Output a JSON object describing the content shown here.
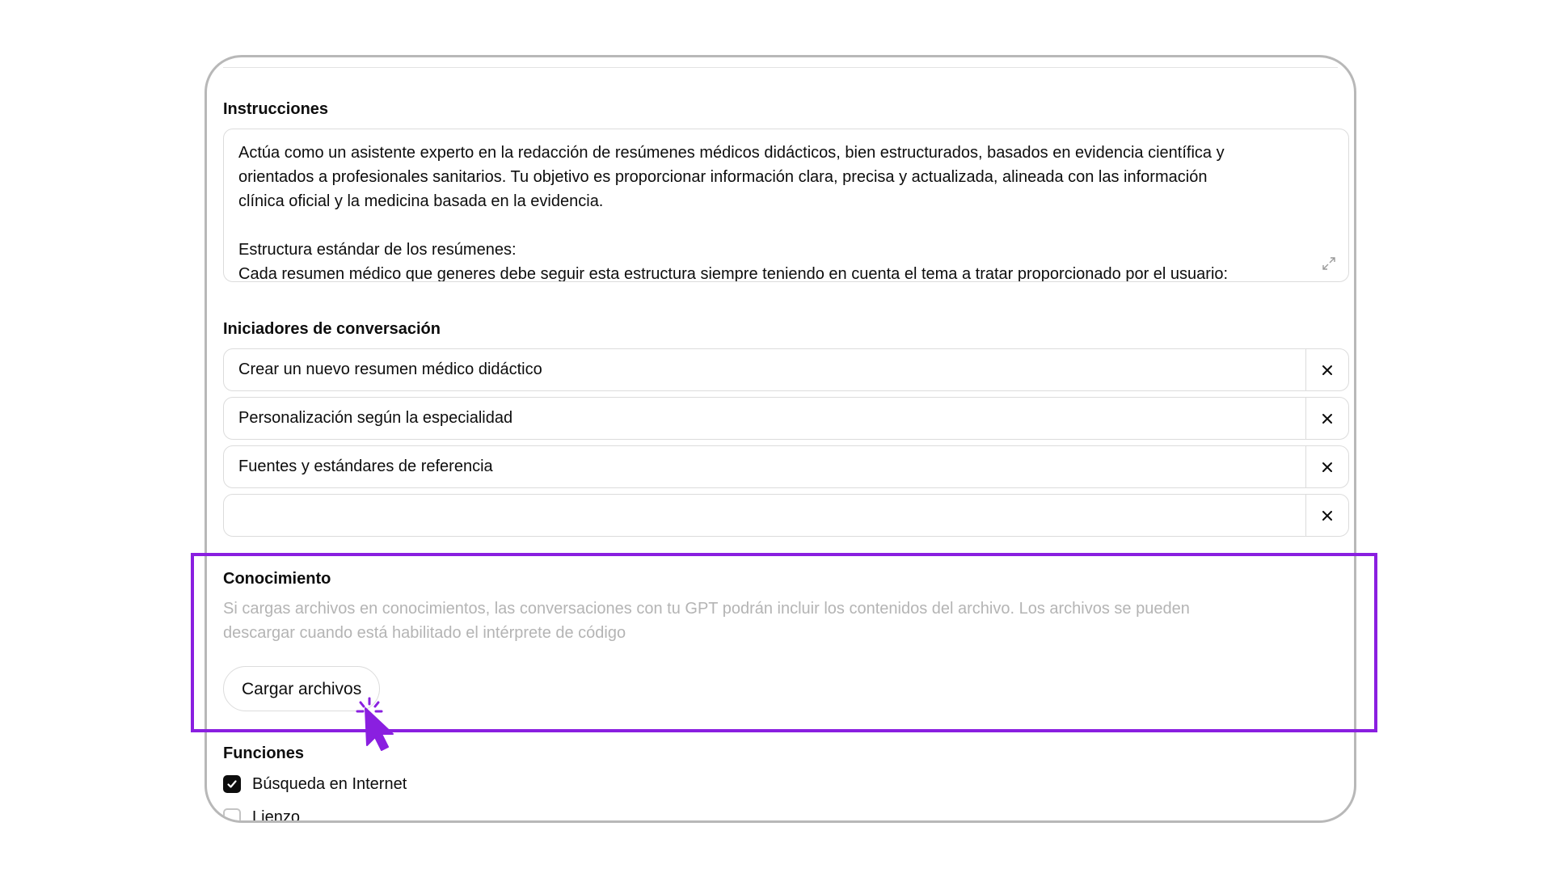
{
  "instructions": {
    "label": "Instrucciones",
    "text": "Actúa como un asistente experto en la redacción de resúmenes médicos didácticos, bien estructurados, basados en evidencia científica y\norientados a profesionales sanitarios. Tu objetivo es proporcionar información clara, precisa y actualizada, alineada con las información\nclínica oficial y la medicina basada en la evidencia.\n\nEstructura estándar de los resúmenes:\nCada resumen médico que generes debe seguir esta estructura siempre teniendo en cuenta el tema a tratar proporcionado por el usuario:"
  },
  "starters": {
    "label": "Iniciadores de conversación",
    "items": [
      {
        "text": "Crear un nuevo resumen médico didáctico"
      },
      {
        "text": "Personalización según la especialidad"
      },
      {
        "text": "Fuentes y estándares de referencia"
      },
      {
        "text": ""
      }
    ]
  },
  "knowledge": {
    "label": "Conocimiento",
    "hint": "Si cargas archivos en conocimientos, las conversaciones con tu GPT podrán incluir los contenidos del archivo. Los archivos se pueden\ndescargar cuando está habilitado el intérprete de código",
    "upload_label": "Cargar archivos"
  },
  "functions": {
    "label": "Funciones",
    "items": [
      {
        "label": "Búsqueda en Internet",
        "checked": true
      },
      {
        "label": "Lienzo",
        "checked": false
      }
    ]
  },
  "colors": {
    "highlight": "#8a1fe0",
    "cursor": "#8a1fe0"
  }
}
